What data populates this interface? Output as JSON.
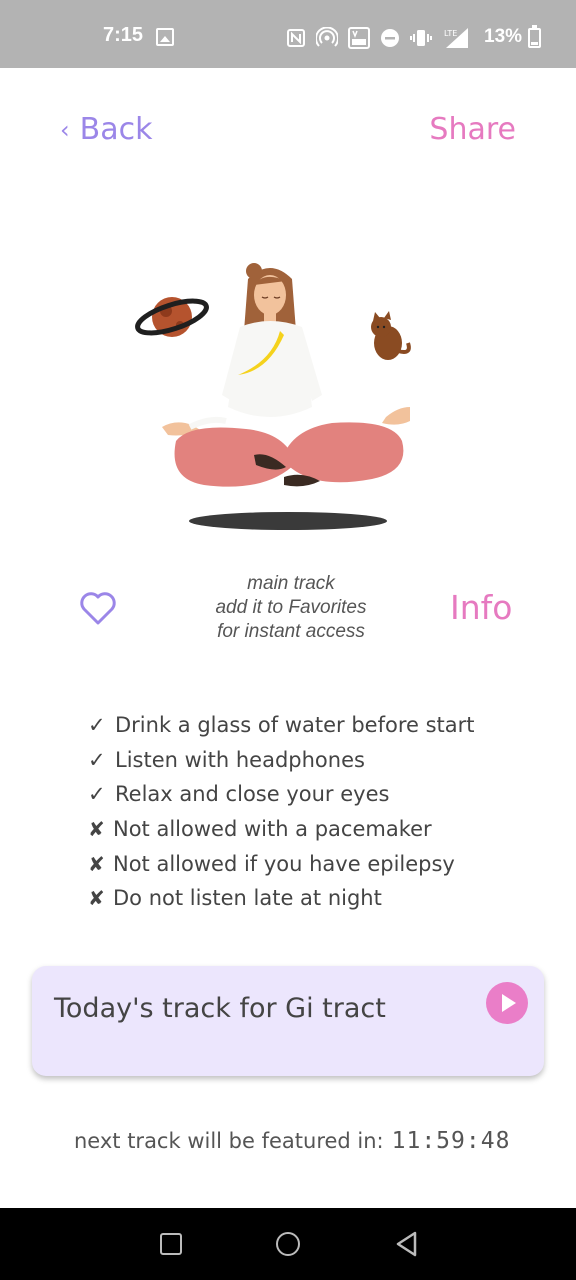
{
  "status_bar": {
    "time": "7:15",
    "battery": "13%",
    "icons": [
      "image-icon",
      "nfc-icon",
      "hotspot-icon",
      "volte-icon",
      "dnd-icon",
      "vibrate-icon",
      "lte-signal-icon",
      "battery-icon"
    ]
  },
  "header": {
    "back_label": "Back",
    "share_label": "Share"
  },
  "track": {
    "caption_line1": "main track",
    "caption_line2": "add it to Favorites",
    "caption_line3": "for instant access",
    "info_label": "Info"
  },
  "checklist": [
    {
      "mark": "✓",
      "text": "Drink a glass of water before start"
    },
    {
      "mark": "✓",
      "text": "Listen with headphones"
    },
    {
      "mark": "✓",
      "text": "Relax and close your eyes"
    },
    {
      "mark": "✘",
      "text": "Not allowed with a pacemaker"
    },
    {
      "mark": "✘",
      "text": "Not allowed if you have epilepsy"
    },
    {
      "mark": "✘",
      "text": "Do not listen late at night"
    }
  ],
  "card": {
    "title": "Today's track for Gi tract"
  },
  "countdown": {
    "label": "next track will be featured in:",
    "time": "11:59:48"
  },
  "colors": {
    "accent_purple": "#9b86e8",
    "accent_pink": "#e67ac0",
    "card_bg": "#ece6fd"
  }
}
